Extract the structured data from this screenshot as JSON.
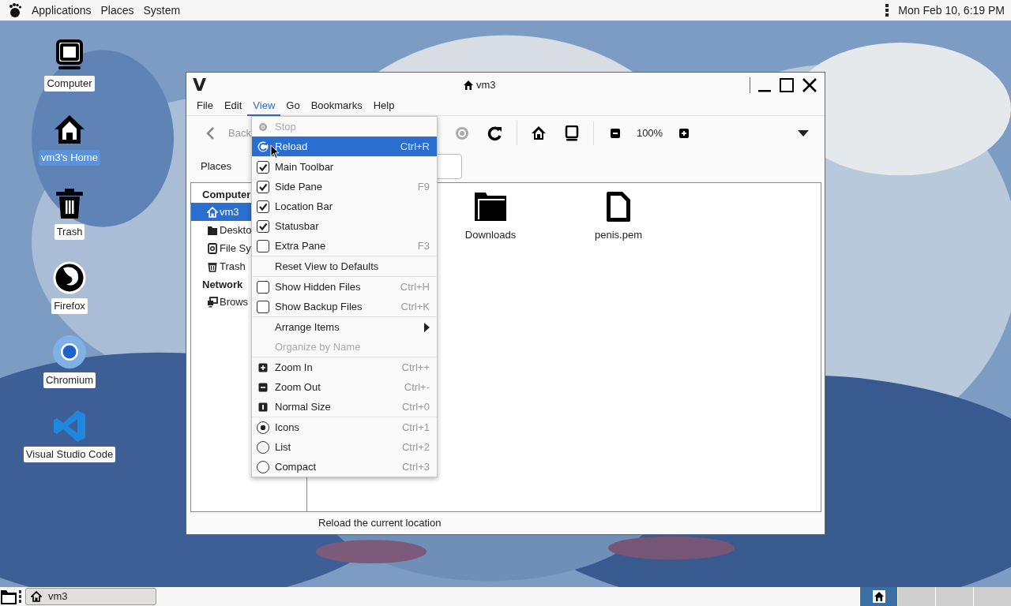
{
  "top_panel": {
    "menus": [
      "Applications",
      "Places",
      "System"
    ],
    "clock": "Mon Feb 10, 6:19 PM"
  },
  "desktop_icons": [
    {
      "label": "Computer",
      "selected": false
    },
    {
      "label": "vm3's Home",
      "selected": true
    },
    {
      "label": "Trash",
      "selected": false
    },
    {
      "label": "Firefox",
      "selected": false
    },
    {
      "label": "Chromium",
      "selected": false
    },
    {
      "label": "Visual Studio Code",
      "selected": false
    }
  ],
  "window": {
    "logo": "V",
    "title": "vm3",
    "menubar": [
      {
        "label": "File",
        "selected": false
      },
      {
        "label": "Edit",
        "selected": false
      },
      {
        "label": "View",
        "selected": true
      },
      {
        "label": "Go",
        "selected": false
      },
      {
        "label": "Bookmarks",
        "selected": false
      },
      {
        "label": "Help",
        "selected": false
      }
    ],
    "toolbar": {
      "back": "Back",
      "zoom": "100%"
    },
    "location_bar": {
      "side_pane_title": "Places"
    },
    "side_pane": [
      {
        "heading": "Computer",
        "items": [
          {
            "label": "vm3",
            "selected": true
          },
          {
            "label": "Deskto",
            "selected": false
          },
          {
            "label": "File Sy",
            "selected": false
          },
          {
            "label": "Trash",
            "selected": false
          }
        ]
      },
      {
        "heading": "Network",
        "items": [
          {
            "label": "Brows",
            "selected": false
          }
        ]
      }
    ],
    "files": [
      {
        "name": "Downloads",
        "kind": "folder"
      },
      {
        "name": "penis.pem",
        "kind": "file"
      }
    ],
    "status_bar": "Reload the current location"
  },
  "view_menu": {
    "sections": [
      {
        "items": [
          {
            "label": "Stop",
            "kind": "action",
            "disabled": true,
            "highlighted": false
          },
          {
            "label": "Reload",
            "kind": "action",
            "shortcut": "Ctrl+R",
            "disabled": false,
            "highlighted": true
          }
        ]
      },
      {
        "items": [
          {
            "label": "Main Toolbar",
            "kind": "check",
            "checked": true,
            "disabled": false,
            "highlighted": false
          },
          {
            "label": "Side Pane",
            "kind": "check",
            "checked": true,
            "shortcut": "F9",
            "disabled": false,
            "highlighted": false
          },
          {
            "label": "Location Bar",
            "kind": "check",
            "checked": true,
            "disabled": false,
            "highlighted": false
          },
          {
            "label": "Statusbar",
            "kind": "check",
            "checked": true,
            "disabled": false,
            "highlighted": false
          },
          {
            "label": "Extra Pane",
            "kind": "check",
            "checked": false,
            "shortcut": "F3",
            "disabled": false,
            "highlighted": false
          }
        ]
      },
      {
        "items": [
          {
            "label": "Reset View to Defaults",
            "kind": "action",
            "disabled": false,
            "highlighted": false
          }
        ]
      },
      {
        "items": [
          {
            "label": "Show Hidden Files",
            "kind": "check",
            "checked": false,
            "shortcut": "Ctrl+H",
            "disabled": false,
            "highlighted": false
          },
          {
            "label": "Show Backup Files",
            "kind": "check",
            "checked": false,
            "shortcut": "Ctrl+K",
            "disabled": false,
            "highlighted": false
          }
        ]
      },
      {
        "items": [
          {
            "label": "Arrange Items",
            "kind": "submenu",
            "disabled": false,
            "highlighted": false
          },
          {
            "label": "Organize by Name",
            "kind": "action",
            "disabled": true,
            "highlighted": false
          }
        ]
      },
      {
        "items": [
          {
            "label": "Zoom In",
            "kind": "action",
            "shortcut": "Ctrl++",
            "disabled": false,
            "highlighted": false
          },
          {
            "label": "Zoom Out",
            "kind": "action",
            "shortcut": "Ctrl+-",
            "disabled": false,
            "highlighted": false
          },
          {
            "label": "Normal Size",
            "kind": "action",
            "shortcut": "Ctrl+0",
            "disabled": false,
            "highlighted": false
          }
        ]
      },
      {
        "items": [
          {
            "label": "Icons",
            "kind": "radio",
            "selected": true,
            "shortcut": "Ctrl+1",
            "disabled": false,
            "highlighted": false
          },
          {
            "label": "List",
            "kind": "radio",
            "selected": false,
            "shortcut": "Ctrl+2",
            "disabled": false,
            "highlighted": false
          },
          {
            "label": "Compact",
            "kind": "radio",
            "selected": false,
            "shortcut": "Ctrl+3",
            "disabled": false,
            "highlighted": false
          }
        ]
      }
    ]
  },
  "bottom_panel": {
    "tasks": [
      {
        "label": "vm3"
      }
    ],
    "workspaces": [
      {
        "selected": true
      },
      {
        "selected": false
      },
      {
        "selected": false
      },
      {
        "selected": false
      }
    ]
  }
}
